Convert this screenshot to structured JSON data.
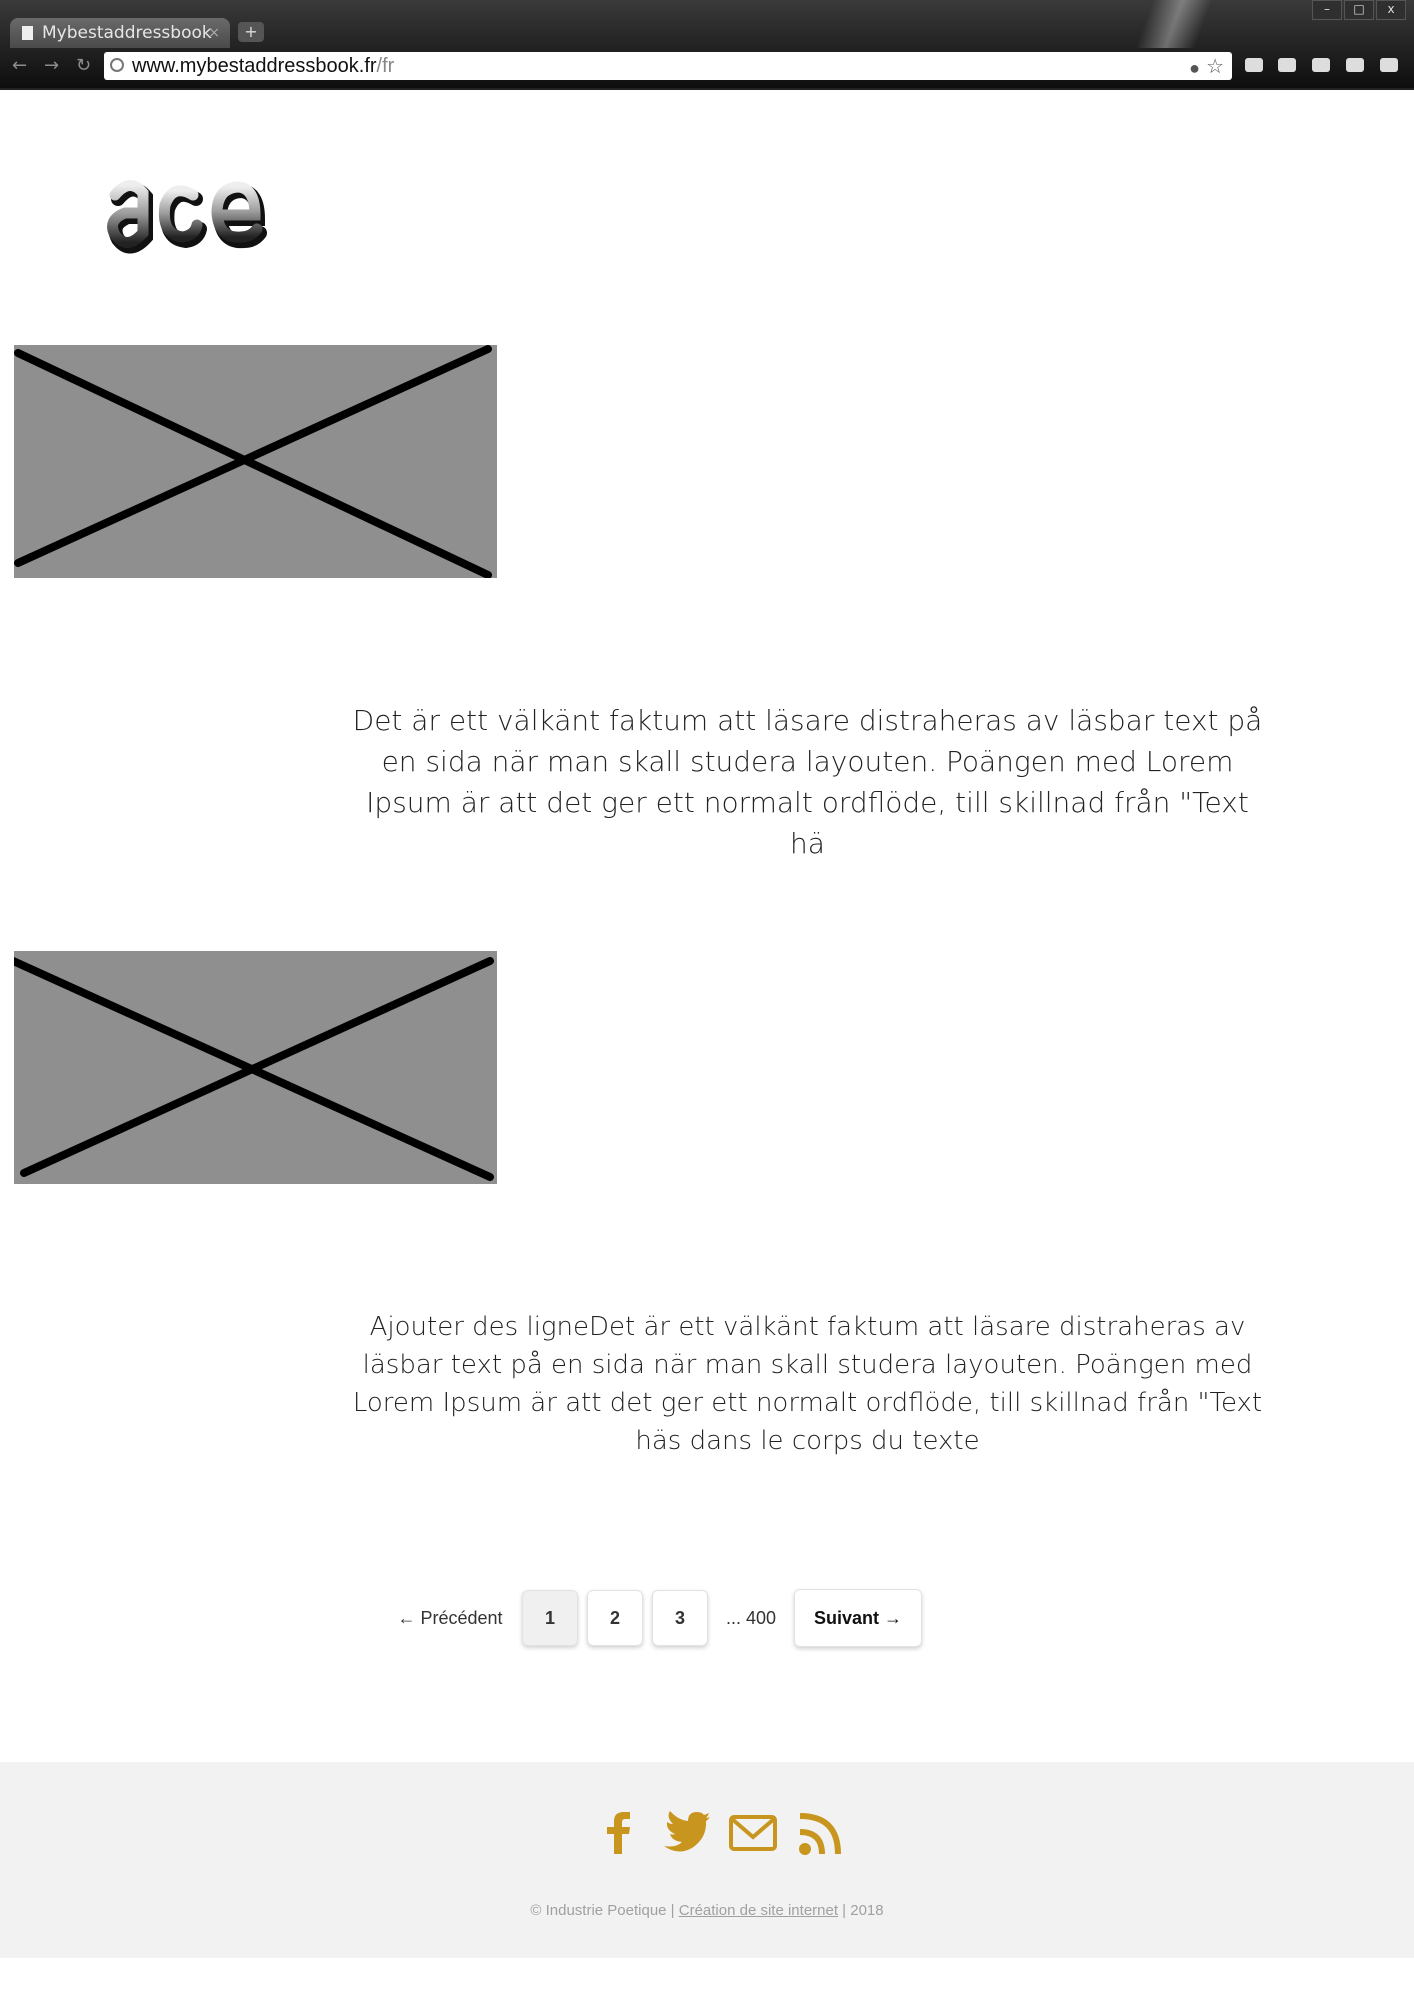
{
  "browser": {
    "tab_title": "Mybestaddressbook",
    "tab_close": "×",
    "new_tab": "+",
    "url_host": "www.mybestaddressbook.fr",
    "url_path": "/fr",
    "window_controls": {
      "minimize": "–",
      "maximize": "□",
      "close": "x"
    }
  },
  "page": {
    "logo_text": "ace",
    "images": [
      {
        "alt": "image placeholder",
        "fill": "#8f8f8f"
      },
      {
        "alt": "image placeholder",
        "fill": "#8f8f8f"
      }
    ],
    "paragraphs": [
      "Det är ett välkänt faktum att läsare distraheras av läsbar text på en sida när man skall studera layouten. Poängen med Lorem Ipsum är att det ger ett normalt ordflöde, till skillnad från \"Text hä",
      "Ajouter des ligneDet är ett välkänt faktum att läsare distraheras av läsbar text på en sida när man skall studera layouten. Poängen med Lorem Ipsum är att det ger ett normalt ordflöde, till skillnad från \"Text häs dans le corps du texte"
    ],
    "pagination": {
      "prev": "← Précédent",
      "pages": [
        "1",
        "2",
        "3"
      ],
      "active_page": "1",
      "ellipsis": "... 400",
      "next": "Suivant →"
    }
  },
  "footer": {
    "social_icons": [
      "facebook-icon",
      "twitter-icon",
      "mail-icon",
      "rss-icon"
    ],
    "copyright_prefix": "© Industrie Poetique | ",
    "copyright_link": "Création de site internet",
    "copyright_suffix": " | 2018",
    "icon_color": "#c8961e"
  }
}
